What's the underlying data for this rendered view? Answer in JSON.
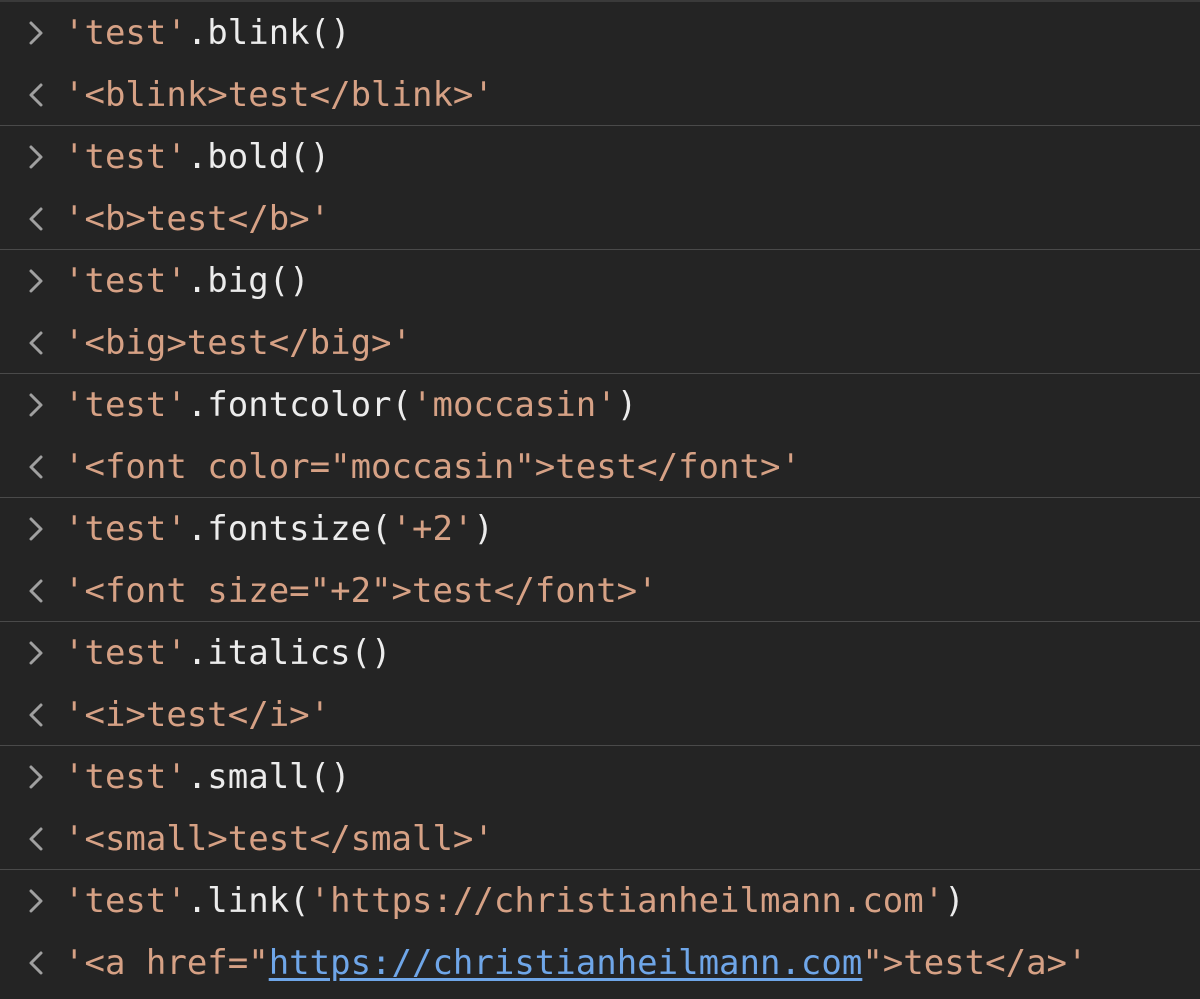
{
  "console": {
    "entries": [
      {
        "input": [
          {
            "text": "'test'",
            "kind": "str"
          },
          {
            "text": ".blink()",
            "kind": "plain"
          }
        ],
        "output": [
          {
            "text": "'<blink>test</blink>'",
            "kind": "str"
          }
        ]
      },
      {
        "input": [
          {
            "text": "'test'",
            "kind": "str"
          },
          {
            "text": ".bold()",
            "kind": "plain"
          }
        ],
        "output": [
          {
            "text": "'<b>test</b>'",
            "kind": "str"
          }
        ]
      },
      {
        "input": [
          {
            "text": "'test'",
            "kind": "str"
          },
          {
            "text": ".big()",
            "kind": "plain"
          }
        ],
        "output": [
          {
            "text": "'<big>test</big>'",
            "kind": "str"
          }
        ]
      },
      {
        "input": [
          {
            "text": "'test'",
            "kind": "str"
          },
          {
            "text": ".fontcolor(",
            "kind": "plain"
          },
          {
            "text": "'moccasin'",
            "kind": "str"
          },
          {
            "text": ")",
            "kind": "plain"
          }
        ],
        "output": [
          {
            "text": "'<font color=\"moccasin\">test</font>'",
            "kind": "str"
          }
        ]
      },
      {
        "input": [
          {
            "text": "'test'",
            "kind": "str"
          },
          {
            "text": ".fontsize(",
            "kind": "plain"
          },
          {
            "text": "'+2'",
            "kind": "str"
          },
          {
            "text": ")",
            "kind": "plain"
          }
        ],
        "output": [
          {
            "text": "'<font size=\"+2\">test</font>'",
            "kind": "str"
          }
        ]
      },
      {
        "input": [
          {
            "text": "'test'",
            "kind": "str"
          },
          {
            "text": ".italics()",
            "kind": "plain"
          }
        ],
        "output": [
          {
            "text": "'<i>test</i>'",
            "kind": "str"
          }
        ]
      },
      {
        "input": [
          {
            "text": "'test'",
            "kind": "str"
          },
          {
            "text": ".small()",
            "kind": "plain"
          }
        ],
        "output": [
          {
            "text": "'<small>test</small>'",
            "kind": "str"
          }
        ]
      },
      {
        "input": [
          {
            "text": "'test'",
            "kind": "str"
          },
          {
            "text": ".link(",
            "kind": "plain"
          },
          {
            "text": "'https://christianheilmann.com'",
            "kind": "str"
          },
          {
            "text": ")",
            "kind": "plain"
          }
        ],
        "output": [
          {
            "text": "'<a href=\"",
            "kind": "str"
          },
          {
            "text": "https://christianheilmann.com",
            "kind": "url"
          },
          {
            "text": "\">test</a>'",
            "kind": "str"
          }
        ]
      }
    ]
  },
  "icons": {
    "input": "chevron-right-icon",
    "output": "chevron-left-icon"
  },
  "colors": {
    "background": "#242424",
    "string": "#d6a185",
    "code": "#ececec",
    "link": "#6fa6e8",
    "chevron": "#a0a0a0",
    "divider": "#4a4a4a"
  }
}
